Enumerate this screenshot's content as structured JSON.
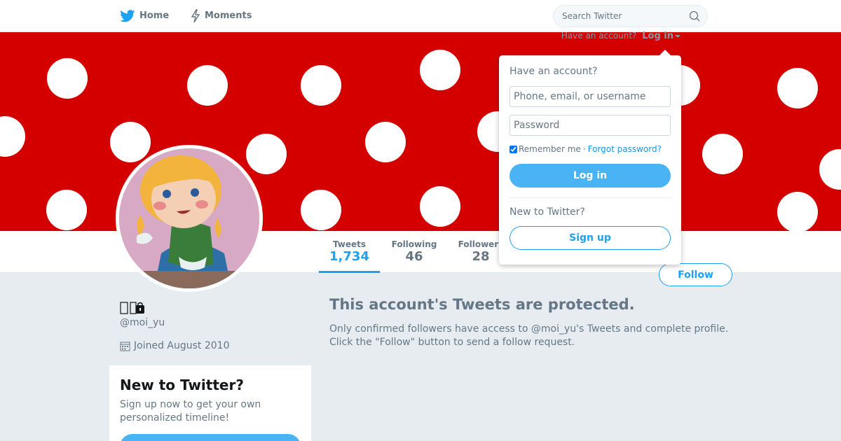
{
  "nav": {
    "home_label": "Home",
    "moments_label": "Moments",
    "home_icon": "bird-icon",
    "moments_icon": "lightning-icon"
  },
  "search": {
    "placeholder": "Search Twitter",
    "value": ""
  },
  "banner": {
    "login_prompt": "Have an account?",
    "login_toggle": "Log in"
  },
  "stats": {
    "tweets_label": "Tweets",
    "tweets_value": "1,734",
    "following_label": "Following",
    "following_value": "46",
    "followers_label": "Followers",
    "followers_value": "28"
  },
  "follow_label": "Follow",
  "profile": {
    "handle": "@moi_yu",
    "joined": "Joined August 2010"
  },
  "signup_card": {
    "title": "New to Twitter?",
    "text": "Sign up now to get your own personalized timeline!"
  },
  "protected": {
    "title": "This account's Tweets are protected.",
    "text": "Only confirmed followers have access to @moi_yu's Tweets and complete profile. Click the \"Follow\" button to send a follow request."
  },
  "login_dropdown": {
    "heading": "Have an account?",
    "username_placeholder": "Phone, email, or username",
    "password_placeholder": "Password",
    "remember_label": "Remember me",
    "separator": "·",
    "forgot_label": "Forgot password?",
    "login_button": "Log in",
    "new_heading": "New to Twitter?",
    "signup_button": "Sign up"
  },
  "colors": {
    "brand": "#1da1f2",
    "banner_red": "#d40000",
    "background": "#e6ecf0"
  }
}
